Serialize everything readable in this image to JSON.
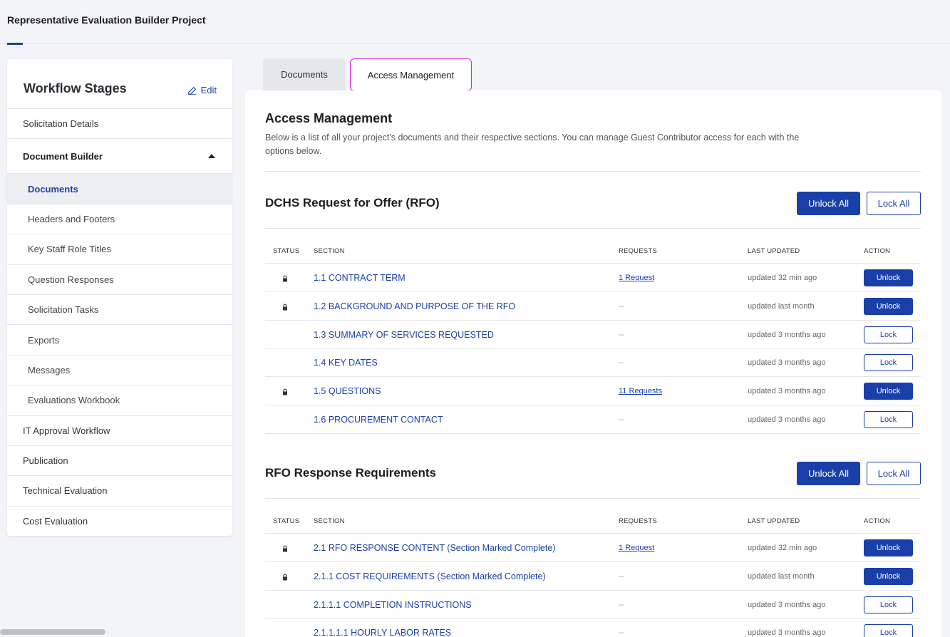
{
  "header": {
    "project_title": "Representative Evaluation Builder Project"
  },
  "sidebar": {
    "title": "Workflow Stages",
    "edit_label": "Edit",
    "items": [
      {
        "label": "Solicitation Details"
      },
      {
        "label": "Document Builder"
      },
      {
        "label": "Documents"
      },
      {
        "label": "Headers and Footers"
      },
      {
        "label": "Key Staff Role Titles"
      },
      {
        "label": "Question Responses"
      },
      {
        "label": "Solicitation Tasks"
      },
      {
        "label": "Exports"
      },
      {
        "label": "Messages"
      },
      {
        "label": "Evaluations Workbook"
      },
      {
        "label": "IT Approval Workflow"
      },
      {
        "label": "Publication"
      },
      {
        "label": "Technical Evaluation"
      },
      {
        "label": "Cost Evaluation"
      }
    ]
  },
  "tabs": {
    "documents": "Documents",
    "access": "Access Management"
  },
  "main": {
    "title": "Access Management",
    "description": "Below is a list of all your project's documents and their respective sections. You can manage Guest Contributor access for each with the options below.",
    "columns": {
      "status": "STATUS",
      "section": "SECTION",
      "requests": "REQUESTS",
      "last_updated": "LAST UPDATED",
      "action": "ACTION"
    },
    "unlock_all": "Unlock All",
    "lock_all": "Lock All",
    "sections": [
      {
        "title": "DCHS Request for Offer (RFO)",
        "rows": [
          {
            "locked": true,
            "section": "1.1 CONTRACT TERM",
            "requests": "1 Request",
            "updated": "updated 32 min ago",
            "action": "Unlock"
          },
          {
            "locked": true,
            "section": "1.2 BACKGROUND AND PURPOSE OF THE RFO",
            "requests": "--",
            "updated": "updated last month",
            "action": "Unlock"
          },
          {
            "locked": false,
            "section": "1.3 SUMMARY OF SERVICES REQUESTED",
            "requests": "--",
            "updated": "updated 3 months ago",
            "action": "Lock"
          },
          {
            "locked": false,
            "section": "1.4 KEY DATES",
            "requests": "--",
            "updated": "updated 3 months ago",
            "action": "Lock"
          },
          {
            "locked": true,
            "section": "1.5 QUESTIONS",
            "requests": "11 Requests",
            "updated": "updated 3 months ago",
            "action": "Unlock"
          },
          {
            "locked": false,
            "section": "1.6 PROCUREMENT CONTACT",
            "requests": "--",
            "updated": "updated 3 months ago",
            "action": "Lock"
          }
        ]
      },
      {
        "title": "RFO Response Requirements",
        "rows": [
          {
            "locked": true,
            "section": "2.1 RFO RESPONSE CONTENT (Section Marked Complete)",
            "requests": "1 Request",
            "updated": "updated 32 min ago",
            "action": "Unlock"
          },
          {
            "locked": true,
            "section": "2.1.1 COST REQUIREMENTS (Section Marked Complete)",
            "requests": "--",
            "updated": "updated last month",
            "action": "Unlock"
          },
          {
            "locked": false,
            "section": "2.1.1.1 COMPLETION INSTRUCTIONS",
            "requests": "--",
            "updated": "updated 3 months ago",
            "action": "Lock"
          },
          {
            "locked": false,
            "section": "2.1.1.1.1 HOURLY LABOR RATES",
            "requests": "--",
            "updated": "updated 3 months ago",
            "action": "Lock"
          }
        ]
      }
    ]
  },
  "colors": {
    "accent": "#1a3fa8",
    "tab_highlight": "#e021d9"
  },
  "icons": {
    "edit": "edit-icon",
    "lock": "lock-icon",
    "caret": "caret-up-icon"
  }
}
